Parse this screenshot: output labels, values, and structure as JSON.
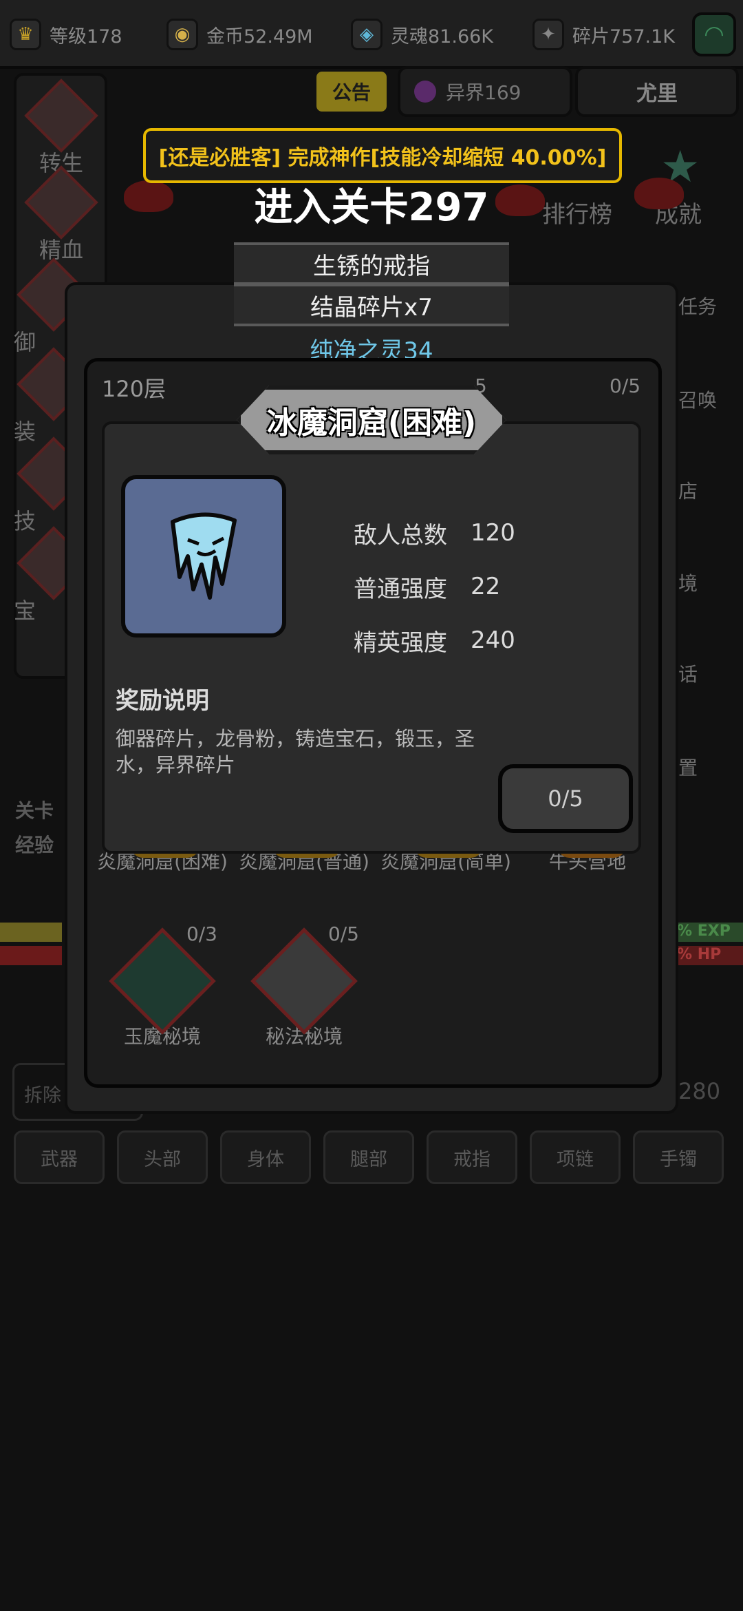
{
  "resources": [
    {
      "label": "等级178",
      "icon": "crown-icon"
    },
    {
      "label": "金币52.49M",
      "icon": "coin-icon"
    },
    {
      "label": "灵魂81.66K",
      "icon": "soul-icon"
    },
    {
      "label": "碎片757.1K",
      "icon": "shard-icon"
    }
  ],
  "header": {
    "notice_tab": "公告",
    "otherworld": "异界169",
    "player_name": "尤里"
  },
  "left_menu": [
    "转生",
    "精血",
    "御",
    "装",
    "技",
    "宝"
  ],
  "right_menu": [
    "排行榜",
    "成就",
    "任务",
    "召唤",
    "店",
    "境",
    "话",
    "置"
  ],
  "bottom_tabs": [
    "武器",
    "头部",
    "身体",
    "腿部",
    "戒指",
    "项链",
    "手镯"
  ],
  "bg_misc": {
    "stage_label": "关卡",
    "exp_label": "经验",
    "remove_label": "拆除",
    "count_280": "280",
    "exp_bar": "% EXP",
    "hp_bar": "% HP"
  },
  "banner": {
    "text": "[还是必胜客] 完成神作[技能冷却缩短 40.00%]"
  },
  "stage": {
    "title": "进入关卡297",
    "drop1": "生锈的戒指",
    "drop2": "结晶碎片x7",
    "soul": "纯净之灵34"
  },
  "dungeon_list": {
    "floor_label": "120层",
    "top_counts": [
      "5",
      "0/5"
    ],
    "items": [
      {
        "name": "炎魔洞窟(困难)"
      },
      {
        "name": "炎魔洞窟(普通)"
      },
      {
        "name": "炎魔洞窟(简单)"
      },
      {
        "name": "牛头营地"
      },
      {
        "name": "玉魔秘境",
        "count": "0/3"
      },
      {
        "name": "秘法秘境",
        "count": "0/5"
      }
    ]
  },
  "modal": {
    "title": "冰魔洞窟(困难)",
    "stats": [
      {
        "key": "敌人总数",
        "value": "120"
      },
      {
        "key": "普通强度",
        "value": "22"
      },
      {
        "key": "精英强度",
        "value": "240"
      }
    ],
    "reward_heading": "奖励说明",
    "reward_text": "御器碎片，龙骨粉，铸造宝石，锻玉，圣水，异界碎片",
    "attempts": "0/5"
  },
  "colors": {
    "banner_gold": "#f2c21b",
    "soul_blue": "#6fc7e8",
    "ice_portrait_bg": "#5a6b93"
  }
}
